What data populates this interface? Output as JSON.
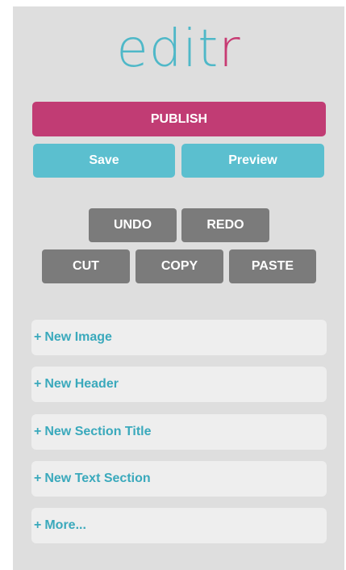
{
  "logo": {
    "part1": "edit",
    "part2": "r"
  },
  "toolbar": {
    "publish": "PUBLISH",
    "save": "Save",
    "preview": "Preview"
  },
  "edit": {
    "undo": "UNDO",
    "redo": "REDO",
    "cut": "CUT",
    "copy": "COPY",
    "paste": "PASTE"
  },
  "add_menu": {
    "items": [
      {
        "prefix": "+",
        "label": "New Image"
      },
      {
        "prefix": "+",
        "label": "New Header"
      },
      {
        "prefix": "+",
        "label": "New Section Title"
      },
      {
        "prefix": "+",
        "label": "New Text Section"
      },
      {
        "prefix": "+",
        "label": "More..."
      }
    ]
  },
  "colors": {
    "panel": "#dedede",
    "logo_teal": "#4fb8c8",
    "logo_pink": "#c73b73",
    "publish": "#c13c74",
    "save_preview": "#5bbfcf",
    "edit_buttons": "#7b7b7b",
    "menu_item_bg": "#eeeeee",
    "menu_item_text": "#3aa9bc"
  }
}
